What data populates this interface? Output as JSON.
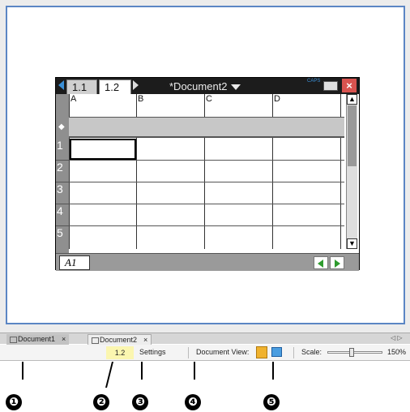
{
  "handheld": {
    "tabs": [
      "1.1",
      "1.2"
    ],
    "active_tab": "1.2",
    "document_title": "*Document2",
    "caps_indicator": "CAPS",
    "close_label": "×",
    "columns": [
      "A",
      "B",
      "C",
      "D"
    ],
    "formula_row_marker": "◆",
    "rows": [
      "1",
      "2",
      "3",
      "4",
      "5"
    ],
    "cell_reference": "A1",
    "scroll_up": "▲",
    "scroll_down": "▼"
  },
  "document_tabs": [
    {
      "label": "Document1",
      "close": "×"
    },
    {
      "label": "Document2",
      "close": "×"
    }
  ],
  "strip_nav": "◁ ▷",
  "statusbar": {
    "page": "1.2",
    "settings": "Settings",
    "document_view": "Document View:",
    "scale_label": "Scale:",
    "scale_value": "150%",
    "scale_level": 0.42
  },
  "callouts": [
    "❶",
    "❷",
    "❸",
    "❹",
    "❺"
  ],
  "colors": {
    "canvas_border": "#5b86c4",
    "page_highlight": "#fbf6b0",
    "handheld_view_button": "#f0b22e",
    "computer_view_button": "#4a9de0"
  }
}
